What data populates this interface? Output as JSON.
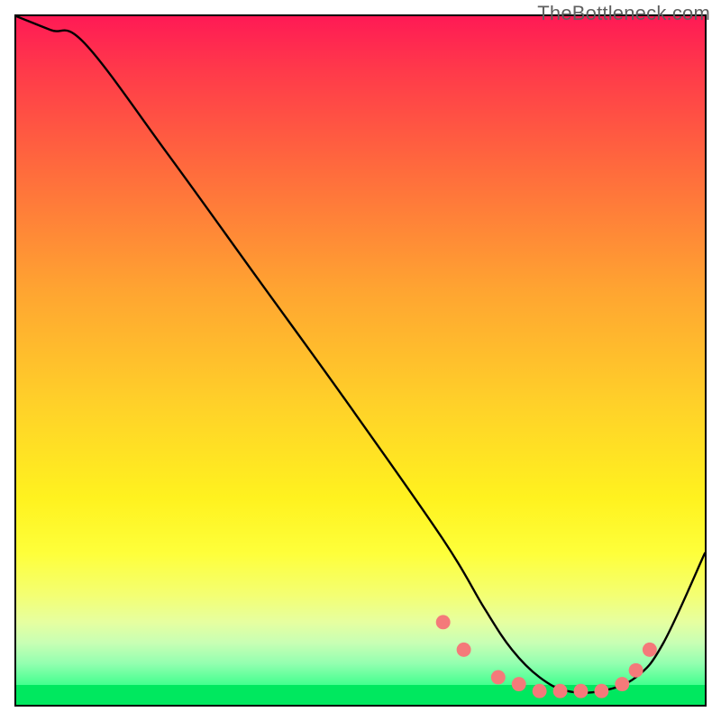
{
  "watermark": "TheBottleneck.com",
  "chart_data": {
    "type": "line",
    "title": "",
    "xlabel": "",
    "ylabel": "",
    "xlim": [
      0,
      100
    ],
    "ylim": [
      0,
      100
    ],
    "series": [
      {
        "name": "curve",
        "x": [
          0,
          5,
          10,
          22,
          35,
          48,
          62,
          68,
          72,
          76,
          80,
          85,
          90,
          94,
          100
        ],
        "values": [
          100,
          98,
          96,
          80,
          62,
          44,
          24,
          14,
          8,
          4,
          2,
          2,
          4,
          9,
          22
        ]
      }
    ],
    "markers": {
      "name": "dots",
      "x": [
        62,
        65,
        70,
        73,
        76,
        79,
        82,
        85,
        88,
        90,
        92
      ],
      "values": [
        12,
        8,
        4,
        3,
        2,
        2,
        2,
        2,
        3,
        5,
        8
      ],
      "color": "#f47a7a",
      "radius_px": 8
    },
    "gradient_stops": [
      {
        "pos": 0,
        "color": "#ff1a55"
      },
      {
        "pos": 70,
        "color": "#fff21f"
      },
      {
        "pos": 100,
        "color": "#00ff6e"
      }
    ]
  }
}
